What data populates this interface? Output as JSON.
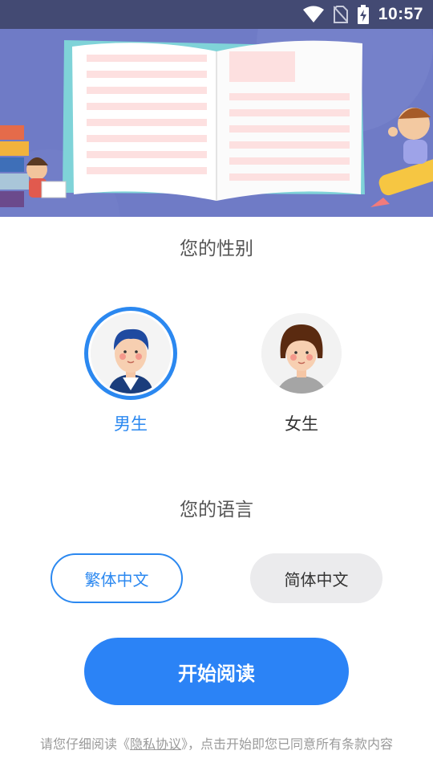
{
  "status_bar": {
    "time": "10:57",
    "icons": [
      "wifi-icon",
      "no-sim-icon",
      "battery-charging-icon"
    ]
  },
  "gender": {
    "title": "您的性别",
    "options": [
      {
        "label": "男生",
        "icon": "boy-avatar-icon",
        "selected": true
      },
      {
        "label": "女生",
        "icon": "girl-avatar-icon",
        "selected": false
      }
    ]
  },
  "language": {
    "title": "您的语言",
    "options": [
      {
        "label": "繁体中文",
        "selected": true
      },
      {
        "label": "简体中文",
        "selected": false
      }
    ]
  },
  "start_button": {
    "label": "开始阅读"
  },
  "agreement": {
    "prefix": "请您仔细阅读《",
    "link": "隐私协议",
    "suffix": "》，点击开始即您已同意所有条款内容"
  },
  "colors": {
    "accent": "#2b88f0",
    "status_bar": "#434a73",
    "banner_bg": "#6d79c4",
    "unselected_bg": "#ebebed"
  }
}
